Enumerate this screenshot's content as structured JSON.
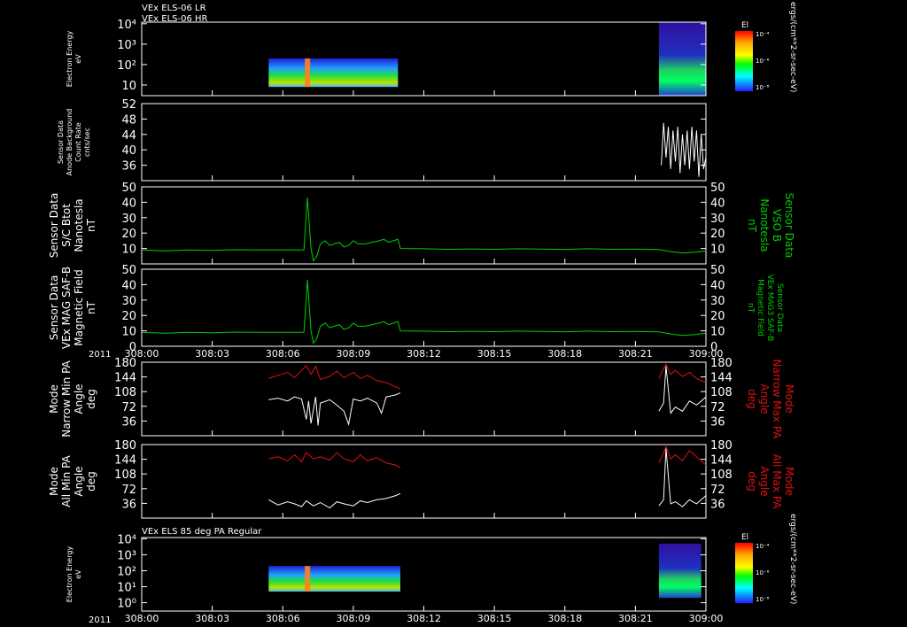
{
  "header": {
    "line1": "VEx ELS-06 LR",
    "line2": "VEx ELS-06 HR",
    "year": "2011"
  },
  "xaxis": {
    "ticks": [
      "308:00",
      "308:03",
      "308:06",
      "308:09",
      "308:12",
      "308:15",
      "308:18",
      "308:21",
      "309:00"
    ],
    "tick_minutes": [
      0,
      3,
      6,
      9,
      12,
      15,
      18,
      21,
      24
    ],
    "range": [
      0,
      24
    ]
  },
  "colorbar": {
    "title": "El",
    "tick_labels": [
      "10⁻⁴",
      "10⁻⁶",
      "10⁻⁸"
    ],
    "units": "ergs/(cm**2-sr-sec-eV)"
  },
  "panel7_title": "VEx ELS 85 deg PA Regular",
  "colors": {
    "white": "#ffffff",
    "green": "#00d000",
    "red": "#e01010",
    "frame": "#ffffff"
  },
  "chart_data": [
    {
      "id": "p1",
      "type": "heatmap",
      "ylabel": [
        "Electron Energy",
        "eV"
      ],
      "yscale": "log",
      "yticks": [
        {
          "v": 10,
          "l": "10"
        },
        {
          "v": 100,
          "l": "10²"
        },
        {
          "v": 1000,
          "l": "10³"
        },
        {
          "v": 10000,
          "l": "10⁴"
        }
      ],
      "ylim": [
        3,
        12000
      ],
      "blocks": [
        {
          "x0": 5.4,
          "x1": 10.9,
          "y0": 8,
          "y1": 200
        },
        {
          "x0": 22.0,
          "x1": 24.0,
          "y0": 3,
          "y1": 12000
        }
      ]
    },
    {
      "id": "p2",
      "type": "line",
      "ylabel": [
        "Sensor Data",
        "Anode Background",
        "Count Rate",
        "cnts/sec"
      ],
      "ylim": [
        32,
        52
      ],
      "yticks": [
        {
          "v": 36,
          "l": "36"
        },
        {
          "v": 40,
          "l": "40"
        },
        {
          "v": 44,
          "l": "44"
        },
        {
          "v": 48,
          "l": "48"
        },
        {
          "v": 52,
          "l": "52"
        }
      ],
      "series": [
        {
          "color": "white",
          "x": [
            22.1,
            22.2,
            22.3,
            22.4,
            22.5,
            22.6,
            22.7,
            22.8,
            22.9,
            23.0,
            23.1,
            23.2,
            23.3,
            23.4,
            23.5,
            23.6,
            23.7,
            23.8,
            23.9,
            24.0
          ],
          "y": [
            36,
            47,
            38,
            46,
            35,
            45,
            37,
            46,
            34,
            44,
            36,
            45,
            35,
            46,
            37,
            45,
            33,
            44,
            35,
            38
          ]
        }
      ]
    },
    {
      "id": "p3",
      "type": "line",
      "ylabel": [
        "Sensor Data",
        "S/C Btot",
        "Nanotesla",
        "nT"
      ],
      "ylabel_right": [
        "Sensor Data",
        "VSO B",
        "Nanotesla",
        "nT"
      ],
      "ylim": [
        0,
        50
      ],
      "yticks": [
        {
          "v": 10,
          "l": "10"
        },
        {
          "v": 20,
          "l": "20"
        },
        {
          "v": 30,
          "l": "30"
        },
        {
          "v": 40,
          "l": "40"
        },
        {
          "v": 50,
          "l": "50"
        }
      ],
      "series": [
        {
          "color": "green",
          "x": [
            0,
            1,
            2,
            3,
            4,
            5,
            6,
            6.9,
            7.05,
            7.2,
            7.3,
            7.45,
            7.6,
            7.8,
            8.0,
            8.2,
            8.4,
            8.6,
            8.8,
            9.0,
            9.2,
            9.5,
            9.8,
            10.1,
            10.3,
            10.5,
            10.7,
            10.9,
            11.0,
            12,
            13,
            14,
            15,
            16,
            17,
            18,
            19,
            20,
            21,
            22,
            22.5,
            23,
            23.5,
            24
          ],
          "y": [
            9,
            8.5,
            9,
            8.8,
            9.2,
            9,
            9,
            9,
            43,
            10,
            2,
            5,
            13,
            15,
            12,
            13,
            14,
            11,
            12,
            15,
            13,
            13,
            14,
            15,
            16,
            14,
            15,
            16,
            10,
            9.8,
            9.5,
            9.7,
            9.5,
            9.8,
            9.6,
            9.4,
            9.8,
            9.5,
            9.6,
            9.3,
            8,
            7,
            7.5,
            8.5
          ]
        }
      ]
    },
    {
      "id": "p4",
      "type": "line",
      "ylabel": [
        "Sensor Data",
        "VEx MAG SAF-B",
        "Magnetic Field",
        "nT"
      ],
      "ylabel_right": [
        "Sensor Data",
        "VEx MAG3 SAF-B",
        "Magnetic Field",
        "nT"
      ],
      "ylim": [
        0,
        50
      ],
      "yticks": [
        {
          "v": 0,
          "l": "0"
        },
        {
          "v": 10,
          "l": "10"
        },
        {
          "v": 20,
          "l": "20"
        },
        {
          "v": 30,
          "l": "30"
        },
        {
          "v": 40,
          "l": "40"
        },
        {
          "v": 50,
          "l": "50"
        }
      ],
      "series": [
        {
          "color": "green",
          "x": [
            0,
            1,
            2,
            3,
            4,
            5,
            6,
            6.9,
            7.05,
            7.2,
            7.3,
            7.45,
            7.6,
            7.8,
            8.0,
            8.2,
            8.4,
            8.6,
            8.8,
            9.0,
            9.2,
            9.5,
            9.8,
            10.1,
            10.3,
            10.5,
            10.7,
            10.9,
            11.0,
            12,
            13,
            14,
            15,
            16,
            17,
            18,
            19,
            20,
            21,
            22,
            22.5,
            23,
            23.5,
            24
          ],
          "y": [
            9,
            8.5,
            9,
            8.8,
            9.2,
            9,
            9,
            9,
            43,
            10,
            2,
            5,
            13,
            15,
            12,
            13,
            14,
            11,
            12,
            15,
            13,
            13,
            14,
            15,
            16,
            14,
            15,
            16,
            10,
            9.8,
            9.5,
            9.7,
            9.5,
            9.8,
            9.6,
            9.4,
            9.8,
            9.5,
            9.6,
            9.3,
            8,
            7,
            7.5,
            8.5
          ]
        }
      ]
    },
    {
      "id": "p5",
      "type": "line",
      "ylabel": [
        "Mode",
        "Narrow Min PA",
        "Angle",
        "deg"
      ],
      "ylabel_right": [
        "Mode",
        "Narrow Max PA",
        "Angle",
        "deg"
      ],
      "ylim": [
        0,
        180
      ],
      "yticks": [
        {
          "v": 36,
          "l": "36"
        },
        {
          "v": 72,
          "l": "72"
        },
        {
          "v": 108,
          "l": "108"
        },
        {
          "v": 144,
          "l": "144"
        },
        {
          "v": 180,
          "l": "180"
        }
      ],
      "series": [
        {
          "color": "red",
          "x": [
            5.4,
            5.8,
            6.2,
            6.5,
            6.8,
            7.0,
            7.2,
            7.4,
            7.6,
            8.0,
            8.3,
            8.6,
            9.0,
            9.3,
            9.6,
            10.0,
            10.4,
            10.8,
            11.0
          ],
          "y": [
            140,
            148,
            155,
            142,
            160,
            172,
            150,
            170,
            138,
            145,
            158,
            142,
            155,
            140,
            148,
            135,
            130,
            120,
            115
          ]
        },
        {
          "color": "white",
          "x": [
            5.4,
            5.8,
            6.2,
            6.5,
            6.8,
            7.0,
            7.1,
            7.2,
            7.4,
            7.5,
            7.6,
            8.0,
            8.3,
            8.6,
            8.8,
            9.0,
            9.3,
            9.6,
            10.0,
            10.2,
            10.4,
            10.8,
            11.0
          ],
          "y": [
            88,
            92,
            85,
            95,
            90,
            40,
            85,
            30,
            95,
            25,
            80,
            88,
            75,
            60,
            28,
            90,
            85,
            92,
            80,
            55,
            95,
            100,
            105
          ]
        },
        {
          "color": "red",
          "x": [
            22.0,
            22.2,
            22.3,
            22.5,
            22.7,
            23.0,
            23.3,
            23.6,
            24.0
          ],
          "y": [
            140,
            165,
            175,
            150,
            160,
            145,
            155,
            140,
            130
          ]
        },
        {
          "color": "white",
          "x": [
            22.0,
            22.2,
            22.3,
            22.5,
            22.7,
            23.0,
            23.3,
            23.6,
            24.0
          ],
          "y": [
            60,
            80,
            170,
            55,
            70,
            60,
            85,
            75,
            95
          ]
        }
      ]
    },
    {
      "id": "p6",
      "type": "line",
      "ylabel": [
        "Mode",
        "All Min PA",
        "Angle",
        "deg"
      ],
      "ylabel_right": [
        "Mode",
        "All Max PA",
        "Angle",
        "deg"
      ],
      "ylim": [
        0,
        180
      ],
      "yticks": [
        {
          "v": 36,
          "l": "36"
        },
        {
          "v": 72,
          "l": "72"
        },
        {
          "v": 108,
          "l": "108"
        },
        {
          "v": 144,
          "l": "144"
        },
        {
          "v": 180,
          "l": "180"
        }
      ],
      "series": [
        {
          "color": "red",
          "x": [
            5.4,
            5.8,
            6.2,
            6.5,
            6.8,
            7.0,
            7.3,
            7.6,
            8.0,
            8.3,
            8.6,
            9.0,
            9.3,
            9.6,
            10.0,
            10.4,
            10.8,
            11.0
          ],
          "y": [
            145,
            150,
            140,
            155,
            138,
            160,
            145,
            150,
            142,
            160,
            145,
            138,
            155,
            140,
            148,
            135,
            130,
            122
          ]
        },
        {
          "color": "white",
          "x": [
            5.4,
            5.8,
            6.2,
            6.5,
            6.8,
            7.0,
            7.3,
            7.6,
            8.0,
            8.3,
            8.6,
            9.0,
            9.3,
            9.6,
            10.0,
            10.4,
            10.8,
            11.0
          ],
          "y": [
            45,
            32,
            40,
            35,
            28,
            42,
            30,
            38,
            25,
            40,
            35,
            30,
            42,
            38,
            45,
            48,
            55,
            60
          ]
        },
        {
          "color": "red",
          "x": [
            22.0,
            22.2,
            22.3,
            22.5,
            22.7,
            23.0,
            23.3,
            23.6,
            24.0
          ],
          "y": [
            135,
            160,
            175,
            145,
            155,
            140,
            165,
            150,
            130
          ]
        },
        {
          "color": "white",
          "x": [
            22.0,
            22.2,
            22.3,
            22.5,
            22.7,
            23.0,
            23.3,
            23.6,
            24.0
          ],
          "y": [
            30,
            45,
            170,
            35,
            40,
            28,
            45,
            35,
            55
          ]
        }
      ]
    },
    {
      "id": "p7",
      "type": "heatmap",
      "ylabel": [
        "Electron Energy",
        "eV"
      ],
      "yscale": "log",
      "yticks": [
        {
          "v": 1,
          "l": "10⁰"
        },
        {
          "v": 10,
          "l": "10¹"
        },
        {
          "v": 100,
          "l": "10²"
        },
        {
          "v": 1000,
          "l": "10³"
        },
        {
          "v": 10000,
          "l": "10⁴"
        }
      ],
      "ylim": [
        0.3,
        12000
      ],
      "blocks": [
        {
          "x0": 5.4,
          "x1": 11.0,
          "y0": 5,
          "y1": 200
        },
        {
          "x0": 22.0,
          "x1": 23.8,
          "y0": 2,
          "y1": 5000
        }
      ]
    }
  ]
}
